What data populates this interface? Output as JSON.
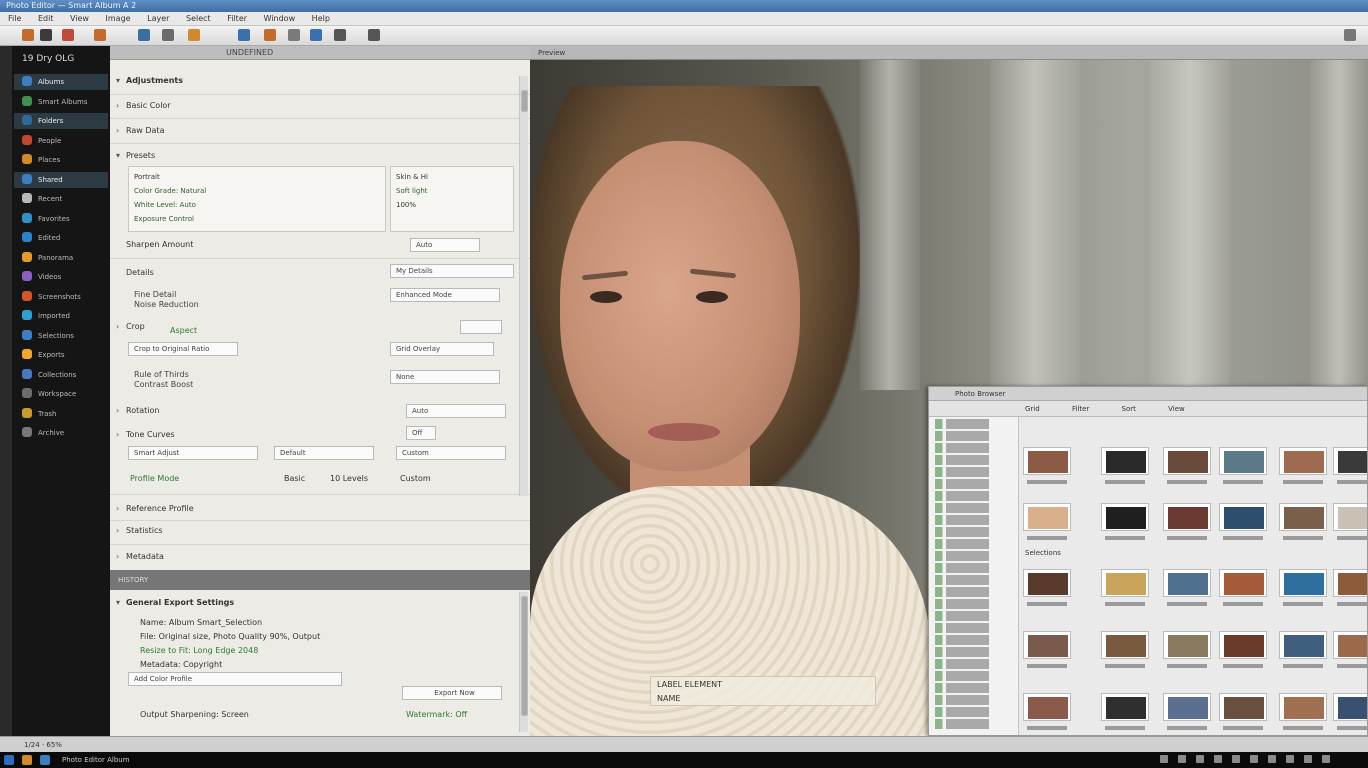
{
  "window": {
    "title": "Photo Editor — Smart Album  A 2"
  },
  "menu": [
    "File",
    "Edit",
    "View",
    "Image",
    "Layer",
    "Select",
    "Filter",
    "Window",
    "Help"
  ],
  "toolbar": {
    "tools": [
      {
        "icon": "brush-icon",
        "color": "#c56b2a"
      },
      {
        "icon": "pen-icon",
        "color": "#3b3b3b"
      },
      {
        "icon": "stamp-icon",
        "color": "#c24a3a"
      },
      {
        "icon": "crop-icon",
        "color": "#c56b2a"
      },
      {
        "icon": "pencil-icon",
        "color": "#3c6ea6"
      },
      {
        "icon": "text-icon",
        "color": "#6b6b6b"
      },
      {
        "icon": "shape-icon",
        "color": "#d08a2c"
      },
      {
        "icon": "select-icon",
        "color": "#3a6fb0"
      },
      {
        "icon": "move-icon",
        "color": "#c56b2a"
      },
      {
        "icon": "zoom-icon",
        "color": "#7a7a7a"
      },
      {
        "icon": "frame-icon",
        "color": "#3a6fb0"
      },
      {
        "icon": "brush-icon",
        "color": "#555555"
      },
      {
        "icon": "paint-icon",
        "color": "#555555"
      }
    ]
  },
  "sidebar": {
    "title": "19 Dry OLG",
    "items": [
      {
        "label": "Albums",
        "color": "#3a7fc2",
        "selected": true
      },
      {
        "label": "Smart Albums",
        "color": "#3f8f4f",
        "selected": false
      },
      {
        "label": "Folders",
        "color": "#2c6a9a",
        "selected": true
      },
      {
        "label": "People",
        "color": "#c2452e",
        "selected": false
      },
      {
        "label": "Places",
        "color": "#d08a2c",
        "selected": false
      },
      {
        "label": "Shared",
        "color": "#3a7fc2",
        "selected": true
      },
      {
        "label": "Recent",
        "color": "#b8b8b8",
        "selected": false
      },
      {
        "label": "Favorites",
        "color": "#2f8fc7",
        "selected": false
      },
      {
        "label": "Edited",
        "color": "#2c82c8",
        "selected": false
      },
      {
        "label": "Panorama",
        "color": "#e09b2a",
        "selected": false
      },
      {
        "label": "Videos",
        "color": "#8a5fbf",
        "selected": false
      },
      {
        "label": "Screenshots",
        "color": "#d1562a",
        "selected": false
      },
      {
        "label": "Imported",
        "color": "#2f9fd0",
        "selected": false
      },
      {
        "label": "Selections",
        "color": "#3a7fc2",
        "selected": false
      },
      {
        "label": "Exports",
        "color": "#f0a72a",
        "selected": false
      },
      {
        "label": "Collections",
        "color": "#4a77c2",
        "selected": false
      },
      {
        "label": "Workspace",
        "color": "#6c6c6c",
        "selected": false
      },
      {
        "label": "Trash",
        "color": "#c89a2a",
        "selected": false
      },
      {
        "label": "Archive",
        "color": "#777777",
        "selected": false
      }
    ]
  },
  "properties": {
    "header": "UNDEFINED",
    "rows": [
      {
        "label": "Adjustments",
        "bold": true
      },
      {
        "label": "Basic Color",
        "bold": false
      },
      {
        "label": "Raw Data",
        "bold": false
      },
      {
        "label": "Presets",
        "bold": false
      }
    ],
    "preset_box": {
      "title": "Portrait",
      "lines": [
        "Color Grade: Natural",
        "White Level: Auto",
        "Exposure Control"
      ]
    },
    "detail_box": {
      "title": "Skin & Hi",
      "line": "Soft light",
      "value": "100%"
    },
    "focus_row": "Sharpen Amount",
    "focus_value": "Auto",
    "details_row": "Details",
    "details_value": "My Details",
    "details_sub": [
      "Fine Detail",
      "Noise Reduction"
    ],
    "details_field": "Enhanced Mode",
    "crop_row": "Crop",
    "crop_value": "Aspect",
    "crop_field_a": "Crop to Original Ratio",
    "crop_field_b": "Grid Overlay",
    "crop_field_c": "Rule of Thirds",
    "layers_note": "Contrast Boost",
    "layers_row": "Rotation",
    "layers_value": "None",
    "layers_toggle": "Auto",
    "tone_row": "Tone Curves",
    "tone_value": "Off",
    "scene_field": "Smart Adjust",
    "scene_a": "Default",
    "scene_b": "Custom",
    "profile_row": "Profile Mode",
    "profile_a": "Basic",
    "profile_b": "10 Levels",
    "profile_c": "Custom",
    "collapsed": [
      {
        "label": "Reference Profile"
      },
      {
        "label": "Statistics"
      },
      {
        "label": "Metadata"
      }
    ],
    "band": "HISTORY",
    "export_header": "General Export Settings",
    "export_lines": [
      "Name: Album Smart_Selection",
      "File: Original size, Photo Quality 90%, Output",
      "Resize to Fit: Long Edge 2048",
      "Metadata: Copyright"
    ],
    "export_field": "Add Color Profile",
    "export_button": "Export Now",
    "export_note_a": "Output Sharpening: Screen",
    "export_note_b": "Watermark: Off"
  },
  "viewer": {
    "header": "Preview",
    "tag_line1": "LABEL ELEMENT",
    "tag_line2": "NAME"
  },
  "browser": {
    "title": "Photo Browser",
    "tool_labels": [
      "Grid",
      "Filter",
      "Sort",
      "View"
    ],
    "group_label": "Selections",
    "colors": [
      "#8d5a45",
      "#2a2a2a",
      "#6a4a3a",
      "#5a7a8a",
      "#a06a50",
      "#3a3a3a",
      "#d9b08c",
      "#1f1f1f",
      "#6b3a30",
      "#2d4f6d",
      "#7a5f4a",
      "#c9c1b4",
      "#5a3a2a",
      "#c9a45a",
      "#4f6f8f",
      "#a55a3a",
      "#2f6f9f",
      "#8b5b3a",
      "#7a5a4a",
      "#7a5a3f",
      "#8a7a5f",
      "#6a3a2a",
      "#3f5f7f",
      "#9a6a4a",
      "#8a5a4a",
      "#2f2f2f",
      "#5a6f8f",
      "#6a4f3f",
      "#a06f4f",
      "#3a5070"
    ]
  },
  "status": {
    "text": "1/24 · 65%",
    "taskbar_label": "Photo Editor Album"
  }
}
